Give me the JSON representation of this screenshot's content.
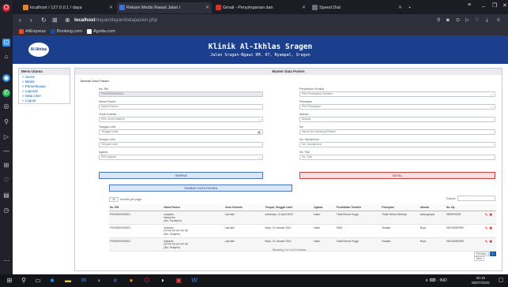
{
  "browser": {
    "tabs": [
      {
        "label": "localhost / 127.0.0.1 / daya",
        "color": "#e8832a"
      },
      {
        "label": "Rekam Medis Rawat Jalan I",
        "color": "#3a6fd8"
      },
      {
        "label": "Gmail - Penyimpanan dan",
        "color": "#d93025"
      },
      {
        "label": "Speed Dial",
        "color": "#6b6e7a"
      }
    ],
    "url_host": "localhost",
    "url_path": "/dayan/dayan/datapasien.php",
    "bookmarks": [
      "AliExpress",
      "Booking.com",
      "Agoda.com"
    ]
  },
  "site": {
    "logo_text": "Al-Ikhlas",
    "title": "Klinik Al-Ikhlas Sragen",
    "address": "Jalan Sragen-Ngawi KM. 07, Nyampal, Sragen"
  },
  "menu": {
    "title": "Menu Utama",
    "items": [
      "» Home",
      "» Medis",
      "» Pemeriksaan",
      "» Laporan",
      "» Data User",
      "» Logout"
    ]
  },
  "form": {
    "title": "Master Data Pasien",
    "subtitle": "Tambah Data Pasien",
    "no_rm_label": "No. RM",
    "no_rm_value": "P0000000000004",
    "nama_label": "Nama Pasien",
    "nama_placeholder": "Nama Pasien",
    "jk_label": "Jenis Kelamin",
    "jk_value": "Pilih Jenis Kelamin",
    "tgl_label": "Tanggal Lahir",
    "tgl_placeholder": "Tanggal Lahir",
    "tmp_label": "Tempat Lahir",
    "tmp_placeholder": "Tempat Lahir",
    "agama_label": "Agama",
    "agama_value": "Pilih Agama",
    "pendidikan_label": "Pendidikan Terakhir",
    "pendidikan_value": "Pilih Pendidikan Terakhir",
    "pekerjaan_label": "Pekerjaan",
    "pekerjaan_value": "Pilih Pekerjaan",
    "alamat_label": "Alamat",
    "alamat_placeholder": "Alamat",
    "ibu_label": "Ibu",
    "ibu_placeholder": "Nama Ibu Kandung Pasien",
    "hp_label": "No. Handphone",
    "hp_placeholder": "No. Handphone",
    "telp_label": "No. Telp",
    "telp_placeholder": "No. Telp",
    "simpan": "SIMPAN",
    "batal": "BATAL",
    "tambah": "TAMBAH DATA PASIEN"
  },
  "table": {
    "entries_value": "10",
    "entries_label": "records per page",
    "search_label": "Search:",
    "headers": [
      "No. RM",
      "Nama Pasien",
      "Jenis Kelamin",
      "Tempat, Tanggal Lahir",
      "Agama",
      "Pendidikan Terakhir",
      "Pekerjaan",
      "Alamat",
      "No. Hp",
      ""
    ],
    "rows": [
      [
        "P0000000000001",
        "suryanto\nNama Ibu\n(Ibu: Sumiyem)",
        "Laki-laki",
        "sukoharjo, 12 April 2000",
        "Islam",
        "Tidak/Tamat Tinggi",
        "Tidak/ Belum Bekerja",
        "karanganyar",
        "0899090090"
      ],
      [
        "P0000000000002",
        "Ariyanto\nPP PP PP PP PP PP\n(Ibu: Sutiyem)",
        "Laki-laki",
        "Boyo, 31 Januari 2014",
        "Islam",
        "SMA",
        "Swasta",
        "Boyo",
        "081234567890"
      ],
      [
        "P0000000000003",
        "Ariyanto\nPP PP PP PP PP PP\n(Ibu: Sutiyem)",
        "Laki-laki",
        "Boyo, 31 Januari 2014",
        "Islam",
        "Tidak/Tamat Tinggi",
        "Swasta",
        "Boyo",
        "081234567890"
      ]
    ],
    "showing": "Showing 1 to 3 of 3 entries",
    "pager": [
      "Previous",
      "1",
      "Next"
    ]
  },
  "taskbar": {
    "tray": "∧  ⌨  ·  IND",
    "time": "20:19",
    "date": "05/07/2020"
  }
}
